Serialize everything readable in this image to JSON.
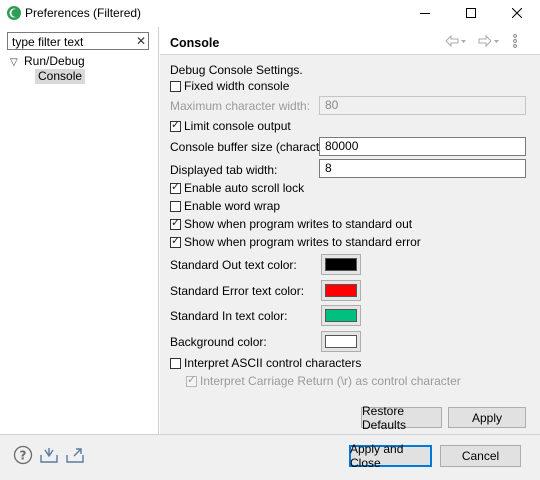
{
  "window": {
    "title": "Preferences (Filtered)",
    "accent_color": "#0078d7"
  },
  "left": {
    "filter_value": "type filter text",
    "tree": [
      {
        "label": "Run/Debug"
      },
      {
        "label": "Console"
      }
    ]
  },
  "page": {
    "title": "Console",
    "description": "Debug Console Settings.",
    "fixed_width": {
      "label": "Fixed width console",
      "checked": false
    },
    "max_char_width": {
      "label": "Maximum character width:",
      "value": "80",
      "disabled": true
    },
    "limit_output": {
      "label": "Limit console output",
      "checked": true
    },
    "buffer_size": {
      "label": "Console buffer size (characters):",
      "value": "80000"
    },
    "tab_width": {
      "label": "Displayed tab width:",
      "value": "8"
    },
    "auto_scroll": {
      "label": "Enable auto scroll lock",
      "checked": true
    },
    "word_wrap": {
      "label": "Enable word wrap",
      "checked": false
    },
    "show_stdout": {
      "label": "Show when program writes to standard out",
      "checked": true
    },
    "show_stderr": {
      "label": "Show when program writes to standard error",
      "checked": true
    },
    "stdout_color": {
      "label": "Standard Out text color:",
      "color": "#000000"
    },
    "stderr_color": {
      "label": "Standard Error text color:",
      "color": "#ff0000"
    },
    "stdin_color": {
      "label": "Standard In text color:",
      "color": "#00c080"
    },
    "bg_color": {
      "label": "Background color:",
      "color": "#ffffff"
    },
    "interpret_ascii": {
      "label": "Interpret ASCII control characters",
      "checked": false
    },
    "interpret_cr": {
      "label": "Interpret Carriage Return (\\r) as control character",
      "checked": true,
      "disabled": true
    },
    "restore_defaults": "Restore Defaults",
    "apply": "Apply"
  },
  "footer": {
    "apply_close": "Apply and Close",
    "cancel": "Cancel"
  }
}
